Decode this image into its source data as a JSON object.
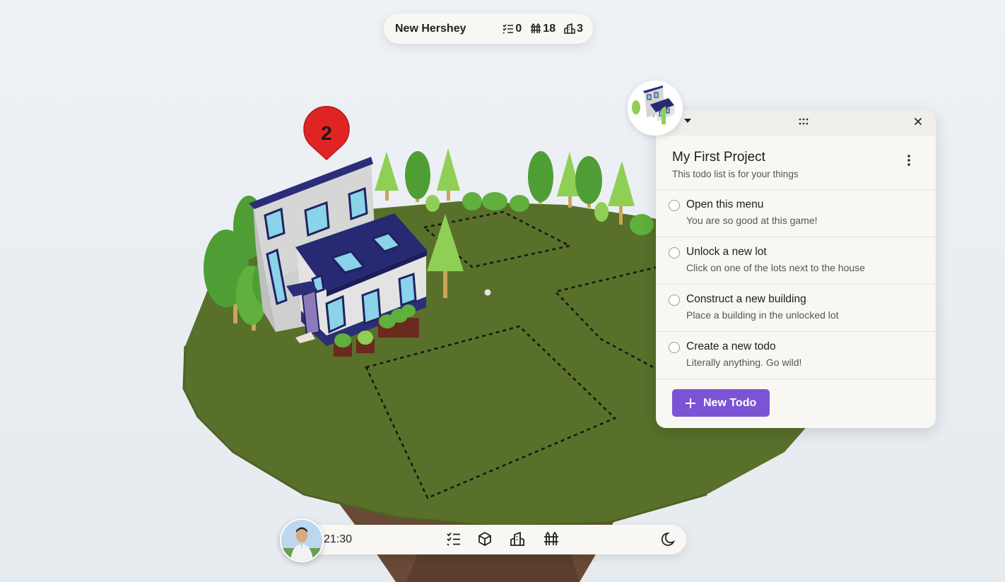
{
  "header": {
    "city_name": "New Hershey",
    "stats": [
      {
        "icon": "checklist-icon",
        "value": "0"
      },
      {
        "icon": "fence-icon",
        "value": "18"
      },
      {
        "icon": "building-icon",
        "value": "3"
      }
    ]
  },
  "scene": {
    "lot_marker": "2"
  },
  "panel": {
    "title": "My First Project",
    "subtitle": "This todo list is for your things",
    "todos": [
      {
        "title": "Open this menu",
        "description": "You are so good at this game!",
        "done": false
      },
      {
        "title": "Unlock a new lot",
        "description": "Click on one of the lots next to the house",
        "done": false
      },
      {
        "title": "Construct a new building",
        "description": "Place a building in the unlocked lot",
        "done": false
      },
      {
        "title": "Create a new todo",
        "description": "Literally anything. Go wild!",
        "done": false
      }
    ],
    "new_todo_label": "New Todo"
  },
  "bottom_bar": {
    "time": "21:30",
    "tools": [
      "checklist-icon",
      "cube-icon",
      "building-icon",
      "fence-icon"
    ],
    "theme_icon": "moon-icon"
  },
  "colors": {
    "accent": "#7b54d6",
    "ground": "#58702a",
    "marker": "#e02424"
  }
}
